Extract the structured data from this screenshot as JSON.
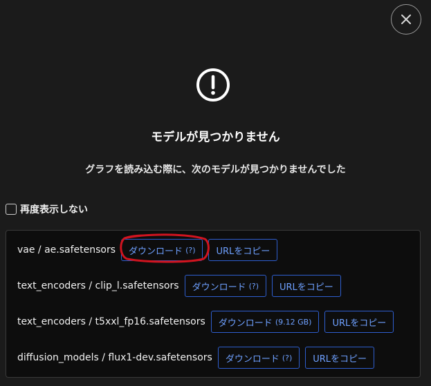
{
  "dialog": {
    "title": "モデルが見つかりません",
    "subtitle": "グラフを読み込む際に、次のモデルが見つかりませんでした",
    "dont_show_again": "再度表示しない",
    "dont_show_checked": false
  },
  "icons": {
    "close": "close-icon",
    "warning": "exclamation-circle-icon"
  },
  "colors": {
    "background": "#1b1b1b",
    "panel": "#0d0d0d",
    "button_border": "#2f5fd0",
    "button_text": "#6ea0ff",
    "annotation": "#d0141f"
  },
  "models": [
    {
      "name": "vae / ae.safetensors",
      "download_label": "ダウンロード",
      "download_size": "(?)",
      "copy_label": "URLをコピー"
    },
    {
      "name": "text_encoders / clip_l.safetensors",
      "download_label": "ダウンロード",
      "download_size": "(?)",
      "copy_label": "URLをコピー"
    },
    {
      "name": "text_encoders / t5xxl_fp16.safetensors",
      "download_label": "ダウンロード",
      "download_size": "(9.12 GB)",
      "copy_label": "URLをコピー"
    },
    {
      "name": "diffusion_models / flux1-dev.safetensors",
      "download_label": "ダウンロード",
      "download_size": "(?)",
      "copy_label": "URLをコピー"
    }
  ]
}
